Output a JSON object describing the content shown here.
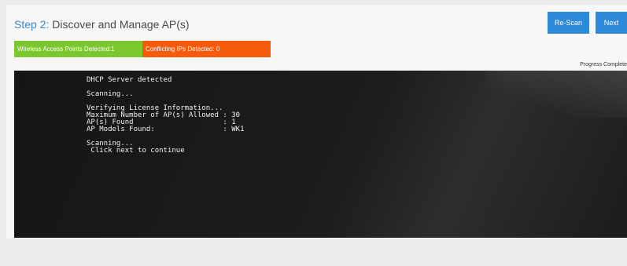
{
  "header": {
    "step_label": "Step 2:",
    "title_text": " Discover and Manage AP(s)"
  },
  "buttons": {
    "rescan_label": "Re-Scan",
    "next_label": "Next"
  },
  "status": {
    "ap_detected": "Wireless Access Points Detected:1",
    "ip_conflicts": "Conflicting IPs Detected: 0"
  },
  "progress_label": "Progress Complete",
  "console": {
    "lines": [
      "DHCP Server detected",
      "",
      "Scanning...",
      "",
      "Verifying License Information...",
      "Maximum Number of AP(s) Allowed : 30",
      "AP(s) Found                     : 1",
      "AP Models Found:                : WK1",
      "",
      "Scanning...",
      " Click next to continue"
    ]
  },
  "colors": {
    "accent": "#2c8ad8",
    "ap_status_bg": "#7cc630",
    "ip_status_bg": "#f65a0b",
    "console_bg": "#1a1a1a"
  }
}
